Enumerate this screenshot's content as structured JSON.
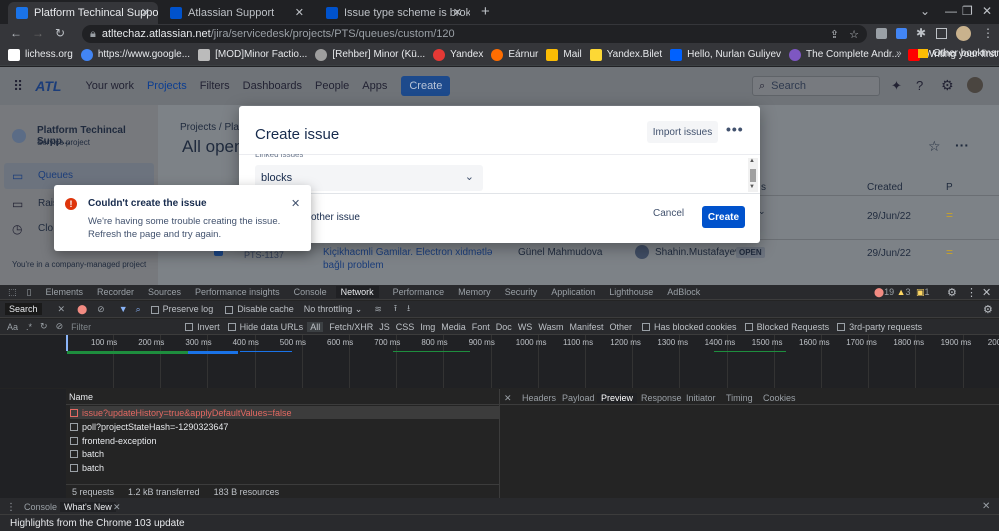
{
  "browser": {
    "tabs": [
      {
        "title": "Platform Techincal Support - Que",
        "color": "#1a73e8"
      },
      {
        "title": "Atlassian Support",
        "color": "#0052cc"
      },
      {
        "title": "Issue type scheme is broken",
        "color": "#0052cc"
      }
    ],
    "new_tab": "+",
    "url_host": "atltechaz.atlassian.net",
    "url_path": "/jira/servicedesk/projects/PTS/queues/custom/120",
    "bookmarks": [
      {
        "label": "lichess.org",
        "color": "#ffffff"
      },
      {
        "label": "https://www.google...",
        "color": "#4285f4"
      },
      {
        "label": "[MOD]Minor Factio...",
        "color": "#bbbbbb"
      },
      {
        "label": "[Rehber] Minor (Kü...",
        "color": "#9e9e9e"
      },
      {
        "label": "Yandex",
        "color": "#e53935"
      },
      {
        "label": "Eárnur",
        "color": "#ff6d00"
      },
      {
        "label": "Mail",
        "color": "#fbbc04"
      },
      {
        "label": "Yandex.Bilet",
        "color": "#fdd835"
      },
      {
        "label": "Hello, Nurlan Guliyev",
        "color": "#0061ff"
      },
      {
        "label": "The Complete Andr...",
        "color": "#7e57c2"
      },
      {
        "label": "Writing your first A...",
        "color": "#ff0000"
      }
    ],
    "bookmarks_overflow": "»",
    "other_bookmarks": "Other bookmarks"
  },
  "jira": {
    "logo_text": "ATL",
    "nav": [
      "Your work",
      "Projects",
      "Filters",
      "Dashboards",
      "People",
      "Apps"
    ],
    "create_label": "Create",
    "search_placeholder": "Search",
    "project_name": "Platform Techincal Supp...",
    "project_type": "Service project",
    "sidebar": [
      "Queues",
      "Rais",
      "Clo"
    ],
    "sidebar_footer": "You're in a company-managed project",
    "breadcrumb": "Projects  /  Plat",
    "page_title": "All open",
    "col_created": "Created",
    "col_p": "P",
    "col_status_frag": "s",
    "rows": [
      {
        "created": "29/Jun/22",
        "priority": "="
      },
      {
        "key": "PTS-1137",
        "summary_line1": "Kiçikhacmli Gamilar. Electron xidmətlə",
        "summary_line2": "bağlı problem",
        "reporter": "Günel Mahmudova",
        "assignee": "Shahin.Mustafayev",
        "status": "OPEN",
        "created": "29/Jun/22",
        "priority": "="
      }
    ]
  },
  "modal": {
    "title": "Create issue",
    "import_label": "Import issues",
    "more_label": "•••",
    "linked_issues_label": "Linked issues",
    "linked_value": "blocks",
    "other_issue_frag": "other issue",
    "cancel_label": "Cancel",
    "create_label": "Create"
  },
  "toast": {
    "title": "Couldn't create the issue",
    "body_line1": "We're having some trouble creating the issue.",
    "body_line2": "Refresh the page and try again."
  },
  "devtools": {
    "tabs": [
      "Elements",
      "Recorder",
      "Sources",
      "Performance insights",
      "Console",
      "Network",
      "Performance",
      "Memory",
      "Security",
      "Application",
      "Lighthouse",
      "AdBlock"
    ],
    "active_tab": "Network",
    "errors": "19",
    "warnings": "3",
    "info": "1",
    "search_label": "Search",
    "preserve_log": "Preserve log",
    "disable_cache": "Disable cache",
    "throttling": "No throttling",
    "filter_placeholder": "Filter",
    "filter_opts": [
      "Invert",
      "Hide data URLs"
    ],
    "types": [
      "All",
      "Fetch/XHR",
      "JS",
      "CSS",
      "Img",
      "Media",
      "Font",
      "Doc",
      "WS",
      "Wasm",
      "Manifest",
      "Other"
    ],
    "blocked_cookies": "Has blocked cookies",
    "blocked_requests": "Blocked Requests",
    "third_party": "3rd-party requests",
    "ticks": [
      "100 ms",
      "200 ms",
      "300 ms",
      "400 ms",
      "500 ms",
      "600 ms",
      "700 ms",
      "800 ms",
      "900 ms",
      "1000 ms",
      "1100 ms",
      "1200 ms",
      "1300 ms",
      "1400 ms",
      "1500 ms",
      "1600 ms",
      "1700 ms",
      "1800 ms",
      "1900 ms",
      "200"
    ],
    "col_name": "Name",
    "requests": [
      {
        "name": "issue?updateHistory=true&applyDefaultValues=false",
        "error": true
      },
      {
        "name": "poll?projectStateHash=-1290323647",
        "error": false
      },
      {
        "name": "frontend-exception",
        "error": false
      },
      {
        "name": "batch",
        "error": false
      },
      {
        "name": "batch",
        "error": false
      }
    ],
    "summary_requests": "5 requests",
    "summary_transferred": "1.2 kB transferred",
    "summary_resources": "183 B resources",
    "detail_tabs": [
      "Headers",
      "Payload",
      "Preview",
      "Response",
      "Initiator",
      "Timing",
      "Cookies"
    ],
    "detail_active": "Preview",
    "drawer_tabs": [
      "Console",
      "What's New"
    ],
    "drawer_line": "Highlights from the Chrome 103 update"
  }
}
